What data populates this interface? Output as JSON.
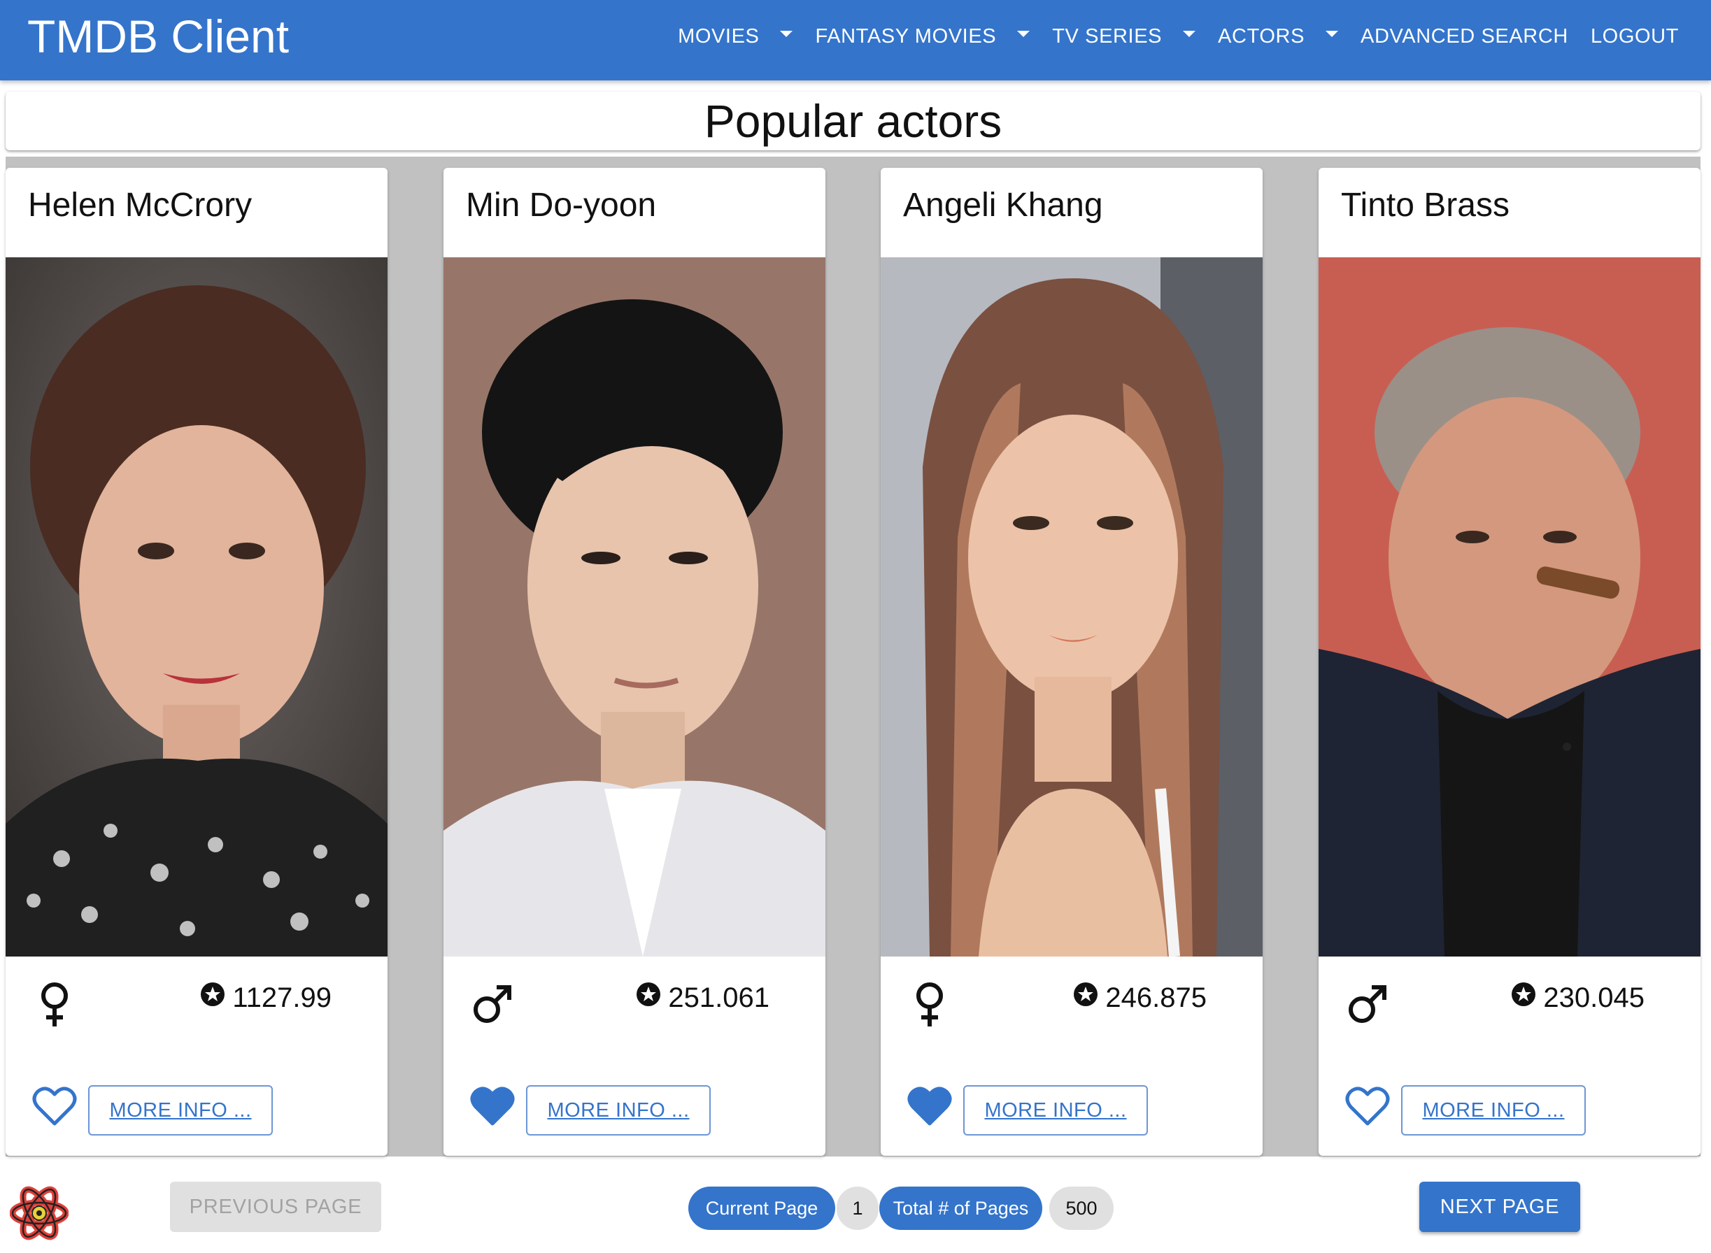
{
  "app": {
    "brand": "TMDB Client",
    "nav": [
      {
        "label": "Movies",
        "dropdown": true
      },
      {
        "label": "Fantasy Movies",
        "dropdown": true
      },
      {
        "label": "TV Series",
        "dropdown": true
      },
      {
        "label": "Actors",
        "dropdown": true
      },
      {
        "label": "Advanced Search",
        "dropdown": false
      },
      {
        "label": "Logout",
        "dropdown": false
      }
    ]
  },
  "page": {
    "title": "Popular actors"
  },
  "actors": [
    {
      "name": "Helen McCrory",
      "gender": "female",
      "popularity": "1127.99",
      "favorite": false,
      "more_label": "More Info ..."
    },
    {
      "name": "Min Do-yoon",
      "gender": "male",
      "popularity": "251.061",
      "favorite": true,
      "more_label": "More Info ..."
    },
    {
      "name": "Angeli Khang",
      "gender": "female",
      "popularity": "246.875",
      "favorite": true,
      "more_label": "More Info ..."
    },
    {
      "name": "Tinto Brass",
      "gender": "male",
      "popularity": "230.045",
      "favorite": false,
      "more_label": "More Info ..."
    }
  ],
  "pagination": {
    "prev_label": "Previous Page",
    "next_label": "Next Page",
    "current_label": "Current Page",
    "current_value": "1",
    "total_label": "Total # of Pages",
    "total_value": "500"
  },
  "colors": {
    "primary": "#3474cb",
    "grid_background": "#c1c1c1",
    "disabled": "#e0e0e0"
  },
  "icons": {
    "female": "female-symbol-icon",
    "male": "male-symbol-icon",
    "popularity": "star-circle-icon",
    "favorite_on": "heart-filled-icon",
    "favorite_off": "heart-outline-icon",
    "footer": "react-logo-icon"
  }
}
